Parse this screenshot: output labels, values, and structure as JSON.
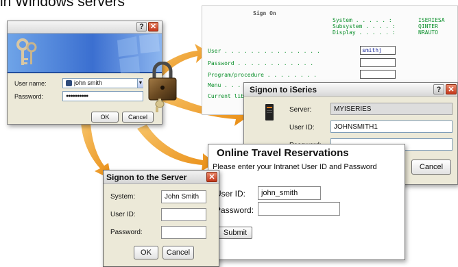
{
  "heading": "in Windows servers",
  "colors": {
    "arrow": "#f0a328",
    "window_bg": "#ece9d8",
    "close_button": "#c3361a",
    "green_text": "#0a8f2a",
    "blue_text": "#1b2a9a"
  },
  "windows_logon": {
    "help_glyph": "?",
    "close_glyph": "✕",
    "username_label": "User name:",
    "username_value": "john smith",
    "password_label": "Password:",
    "password_value": "●●●●●●●●●●",
    "ok_label": "OK",
    "cancel_label": "Cancel"
  },
  "green_screen": {
    "title": "Sign On",
    "system_label": "System . . . . . :",
    "system_value": "ISERIESA",
    "subsystem_label": "Subsystem . . . . :",
    "subsystem_value": "QINTER",
    "display_label": "Display . . . . . :",
    "display_value": "NRAUTO",
    "user_label": "User . . . . . . . . . . . . . . .",
    "user_value": "smithj",
    "password_label": "Password . . . . . . . . . . . .",
    "program_label": "Program/procedure . . . . . . . .",
    "menu_label": "Menu . . .",
    "current_library_label": "Current lib"
  },
  "iseries_signon": {
    "title": "Signon to iSeries",
    "help_glyph": "?",
    "close_glyph": "✕",
    "server_label": "Server:",
    "server_value": "MYISERIES",
    "userid_label": "User ID:",
    "userid_value": "JOHNSMITH1",
    "password_label": "Password:",
    "cancel_label": "Cancel"
  },
  "travel": {
    "title": "Online Travel Reservations",
    "subtitle": "Please enter your Intranet User ID and Password",
    "userid_label": "User ID:",
    "userid_value": "john_smith",
    "password_label": "Password:",
    "submit_label": "Submit"
  },
  "server_signon": {
    "title": "Signon to the Server",
    "close_glyph": "✕",
    "system_label": "System:",
    "system_value": "John Smith",
    "userid_label": "User ID:",
    "password_label": "Password:",
    "ok_label": "OK",
    "cancel_label": "Cancel"
  }
}
